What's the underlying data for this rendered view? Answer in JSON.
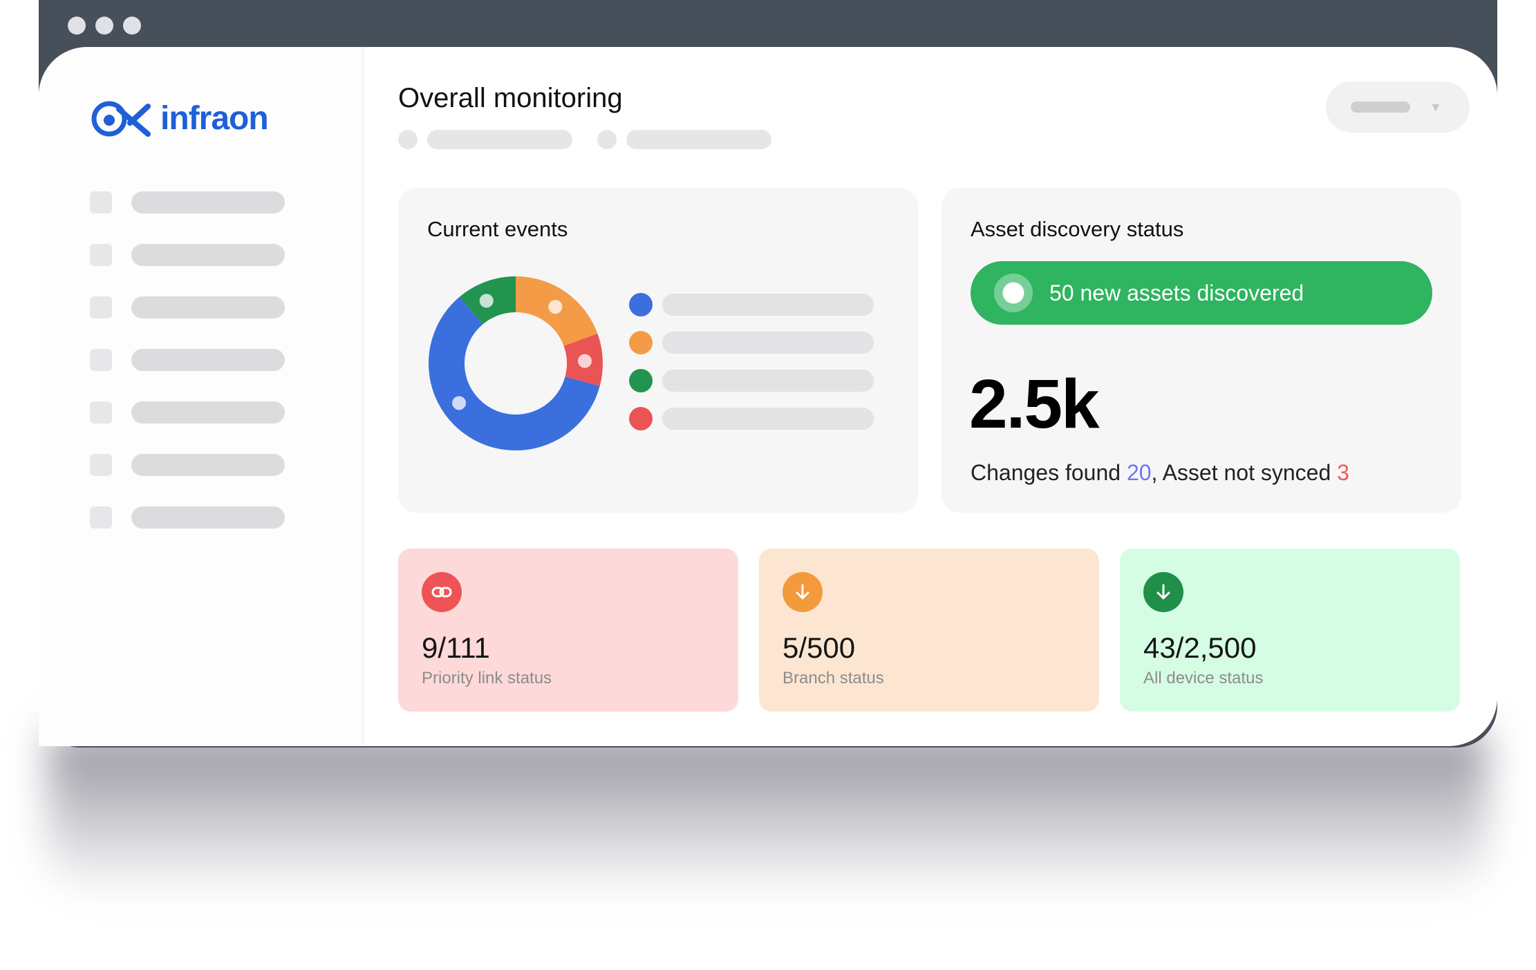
{
  "brand": {
    "name": "infraon",
    "color": "#1f5fd7"
  },
  "page": {
    "title": "Overall monitoring"
  },
  "events": {
    "title": "Current events",
    "donut_colors": [
      "#3b6fde",
      "#f49b47",
      "#ea5454",
      "#22944f"
    ],
    "legend_colors": [
      "#3b6fde",
      "#f49b47",
      "#22944f",
      "#ea5454"
    ]
  },
  "asset_discovery": {
    "title": "Asset discovery status",
    "banner_text": "50 new assets discovered",
    "banner_color": "#2fb45f",
    "total": "2.5k",
    "changes_label": "Changes found ",
    "changes_value": "20",
    "sep": ", ",
    "not_synced_label": "Asset not synced ",
    "not_synced_value": "3"
  },
  "stats": [
    {
      "value": "9/111",
      "label": "Priority link status",
      "icon": "link-icon",
      "bg": "#fdd9d9",
      "icon_bg": "#ee5456"
    },
    {
      "value": "5/500",
      "label": "Branch status",
      "icon": "arrow-down-icon",
      "bg": "#fde6d1",
      "icon_bg": "#f39a3d"
    },
    {
      "value": "43/2,500",
      "label": "All device status",
      "icon": "arrow-down-icon",
      "bg": "#d4fde4",
      "icon_bg": "#1f8f4a"
    }
  ]
}
